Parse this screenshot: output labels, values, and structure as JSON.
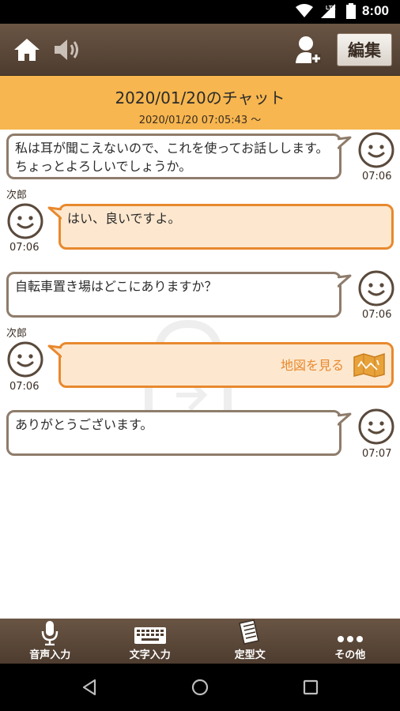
{
  "status_bar": {
    "time": "8:00",
    "network": "LTE",
    "icons": [
      "wifi-icon",
      "cell-signal-icon",
      "battery-icon"
    ]
  },
  "header": {
    "icons": [
      "home-icon",
      "speaker-icon",
      "add-user-icon"
    ],
    "edit_label": "編集"
  },
  "chat_header": {
    "title": "2020/01/20のチャット",
    "started": "2020/01/20 07:05:43 ～"
  },
  "messages": [
    {
      "side": "me",
      "text": "私は耳が聞こえないので、これを使ってお話しします。ちょっとよろしいでしょうか。",
      "time": "07:06"
    },
    {
      "side": "other",
      "sender": "次郎",
      "text": "はい、良いですよ。",
      "time": "07:06"
    },
    {
      "side": "me",
      "text": "自転車置き場はどこにありますか？",
      "time": "07:06"
    },
    {
      "side": "other",
      "sender": "次郎",
      "text": "",
      "map_label": "地図を見る",
      "time": "07:06"
    },
    {
      "side": "me",
      "text": "ありがとうございます。",
      "time": "07:07"
    }
  ],
  "toolbar": {
    "voice_input": "音声入力",
    "text_input": "文字入力",
    "fixed_phrases": "定型文",
    "other": "その他"
  },
  "colors": {
    "header_brown": "#5b4737",
    "title_band": "#f7b64f",
    "other_bubble_border": "#e8892e",
    "other_bubble_fill": "#fde8cf",
    "me_bubble_border": "#8f7c6b"
  }
}
